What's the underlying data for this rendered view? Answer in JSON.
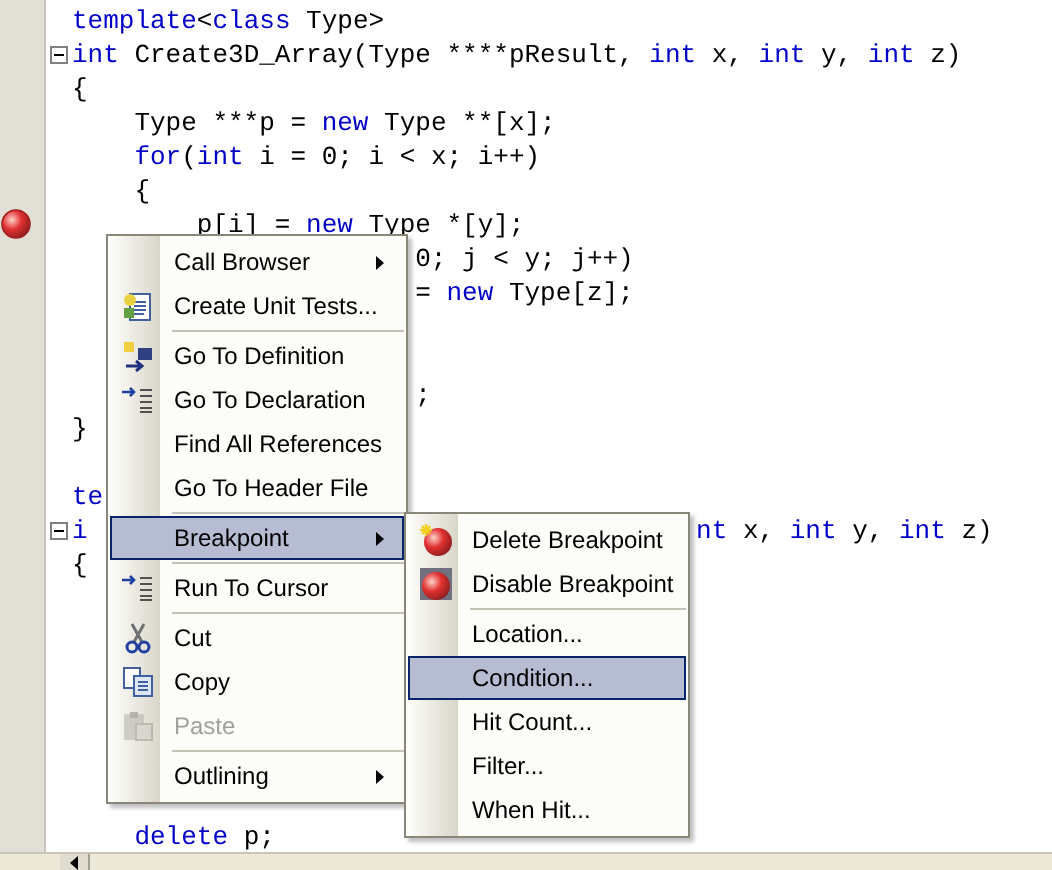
{
  "code": {
    "lines": [
      {
        "tokens": [
          {
            "t": "template",
            "keyword": true
          },
          {
            "t": "<"
          },
          {
            "t": "class",
            "keyword": true
          },
          {
            "t": " Type>"
          }
        ]
      },
      {
        "collapsible": true,
        "tokens": [
          {
            "t": "int",
            "keyword": true
          },
          {
            "t": " Create3D_Array(Type ****pResult, "
          },
          {
            "t": "int",
            "keyword": true
          },
          {
            "t": " x, "
          },
          {
            "t": "int",
            "keyword": true
          },
          {
            "t": " y, "
          },
          {
            "t": "int",
            "keyword": true
          },
          {
            "t": " z)"
          }
        ]
      },
      {
        "tokens": [
          {
            "t": "{"
          }
        ]
      },
      {
        "tokens": [
          {
            "t": "    Type ***p = "
          },
          {
            "t": "new",
            "keyword": true
          },
          {
            "t": " Type **[x];"
          }
        ]
      },
      {
        "tokens": [
          {
            "t": "    for",
            "keyword": true
          },
          {
            "t": "("
          },
          {
            "t": "int",
            "keyword": true
          },
          {
            "t": " i = 0; i < x; i++)"
          }
        ]
      },
      {
        "tokens": [
          {
            "t": "    {"
          }
        ]
      },
      {
        "breakpoint": true,
        "tokens": [
          {
            "t": "        p[i] = "
          },
          {
            "t": "new",
            "keyword": true
          },
          {
            "t": " Type *[y];"
          }
        ]
      },
      {
        "tokens": [
          {
            "t": "                      0; j < y; j++)"
          }
        ]
      },
      {
        "tokens": [
          {
            "t": "                      = "
          },
          {
            "t": "new",
            "keyword": true
          },
          {
            "t": " Type[z];"
          }
        ]
      },
      {
        "blank": true
      },
      {
        "blank": true
      },
      {
        "tokens": [
          {
            "t": "                      ;"
          }
        ]
      },
      {
        "tokens": [
          {
            "t": "}"
          }
        ]
      },
      {
        "blank": true
      },
      {
        "tokens": [
          {
            "t": "te",
            "keyword": true
          }
        ]
      },
      {
        "collapsible": true,
        "tokens": [
          {
            "t": "i",
            "keyword": true
          },
          {
            "t": "                                       nt",
            "keyword": true
          },
          {
            "t": " x, "
          },
          {
            "t": "int",
            "keyword": true
          },
          {
            "t": " y, "
          },
          {
            "t": "int",
            "keyword": true
          },
          {
            "t": " z)"
          }
        ]
      },
      {
        "tokens": [
          {
            "t": "{"
          }
        ]
      },
      {
        "blank": true
      },
      {
        "blank": true
      },
      {
        "blank": true
      },
      {
        "blank": true
      },
      {
        "blank": true
      },
      {
        "blank": true
      },
      {
        "blank": true
      },
      {
        "tokens": [
          {
            "t": "    delete",
            "keyword": true
          },
          {
            "t": " p;"
          }
        ]
      }
    ]
  },
  "context_menu": {
    "items": [
      {
        "kind": "item",
        "label": "Call Browser",
        "submenu": true,
        "selected": false,
        "disabled": false
      },
      {
        "kind": "item",
        "label": "Create Unit Tests...",
        "submenu": false,
        "selected": false,
        "disabled": false
      },
      {
        "kind": "separator"
      },
      {
        "kind": "item",
        "label": "Go To Definition",
        "submenu": false,
        "selected": false,
        "disabled": false
      },
      {
        "kind": "item",
        "label": "Go To Declaration",
        "submenu": false,
        "selected": false,
        "disabled": false
      },
      {
        "kind": "item",
        "label": "Find All References",
        "submenu": false,
        "selected": false,
        "disabled": false
      },
      {
        "kind": "item",
        "label": "Go To Header File",
        "submenu": false,
        "selected": false,
        "disabled": false
      },
      {
        "kind": "separator"
      },
      {
        "kind": "item",
        "label": "Breakpoint",
        "submenu": true,
        "selected": true,
        "disabled": false
      },
      {
        "kind": "separator"
      },
      {
        "kind": "item",
        "label": "Run To Cursor",
        "submenu": false,
        "selected": false,
        "disabled": false
      },
      {
        "kind": "separator"
      },
      {
        "kind": "item",
        "label": "Cut",
        "submenu": false,
        "selected": false,
        "disabled": false
      },
      {
        "kind": "item",
        "label": "Copy",
        "submenu": false,
        "selected": false,
        "disabled": false
      },
      {
        "kind": "item",
        "label": "Paste",
        "submenu": false,
        "selected": false,
        "disabled": true
      },
      {
        "kind": "separator"
      },
      {
        "kind": "item",
        "label": "Outlining",
        "submenu": true,
        "selected": false,
        "disabled": false
      }
    ]
  },
  "submenu": {
    "items": [
      {
        "kind": "item",
        "label": "Delete Breakpoint",
        "submenu": false,
        "selected": false,
        "disabled": false
      },
      {
        "kind": "item",
        "label": "Disable Breakpoint",
        "submenu": false,
        "selected": false,
        "disabled": false
      },
      {
        "kind": "separator"
      },
      {
        "kind": "item",
        "label": "Location...",
        "submenu": false,
        "selected": false,
        "disabled": false
      },
      {
        "kind": "item",
        "label": "Condition...",
        "submenu": false,
        "selected": true,
        "disabled": false
      },
      {
        "kind": "item",
        "label": "Hit Count...",
        "submenu": false,
        "selected": false,
        "disabled": false
      },
      {
        "kind": "item",
        "label": "Filter...",
        "submenu": false,
        "selected": false,
        "disabled": false
      },
      {
        "kind": "item",
        "label": "When Hit...",
        "submenu": false,
        "selected": false,
        "disabled": false
      }
    ]
  }
}
